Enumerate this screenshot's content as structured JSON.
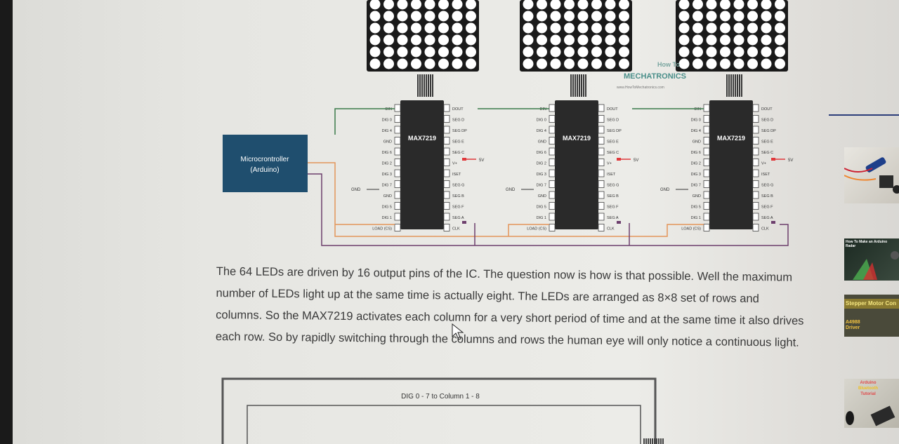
{
  "article": {
    "body_text": "The 64 LEDs are driven by 16 output pins of the IC. The question now is how is that possible. Well the maximum number of LEDs light up at the same time is actually eight. The LEDs are arranged as 8×8 set of rows and columns. So the MAX7219 activates each column for a very short period of time and at the same time it also drives each row. So by rapidly switching through the columns and rows the human eye will only notice a continuous light."
  },
  "diagram": {
    "microcontroller": "Microcrontroller",
    "microcontroller_sub": "(Arduino)",
    "chip_label": "MAX7219",
    "left_pins": [
      "DIN",
      "DIG 0",
      "DIG 4",
      "GND",
      "DIG 6",
      "DIG 2",
      "DIG 3",
      "DIG 7",
      "GND",
      "DIG 5",
      "DIG 1",
      "LOAD (CS)"
    ],
    "right_pins": [
      "DOUT",
      "SEG D",
      "SEG DP",
      "SEG E",
      "SEG C",
      "V+",
      "ISET",
      "SEG G",
      "SEG B",
      "SEG F",
      "SEG A",
      "CLK"
    ],
    "gnd_label": "GND",
    "vcc_label": "5V",
    "watermark_line1": "How To",
    "watermark_line2": "MECHATRONICS",
    "watermark_url": "www.HowToMechatronics.com",
    "bottom_figure_label": "DIG 0 - 7  to  Column 1 - 8"
  },
  "sidebar": {
    "thumb2_title": "How To Make an Arduino Radar",
    "thumb3_title": "Stepper Motor Con",
    "thumb3_sub1": "A4988",
    "thumb3_sub2": "Driver",
    "thumb4_line1": "Arduino",
    "thumb4_line2": "Bluetooth",
    "thumb4_line3": "Tutorial"
  },
  "colors": {
    "mcu_bg": "#1f4e6e",
    "chip": "#2a2a2a",
    "wire_green": "#3a7a4a",
    "wire_orange": "#e3955a",
    "wire_purple": "#6d3f6d",
    "wire_red": "#e0393c"
  }
}
